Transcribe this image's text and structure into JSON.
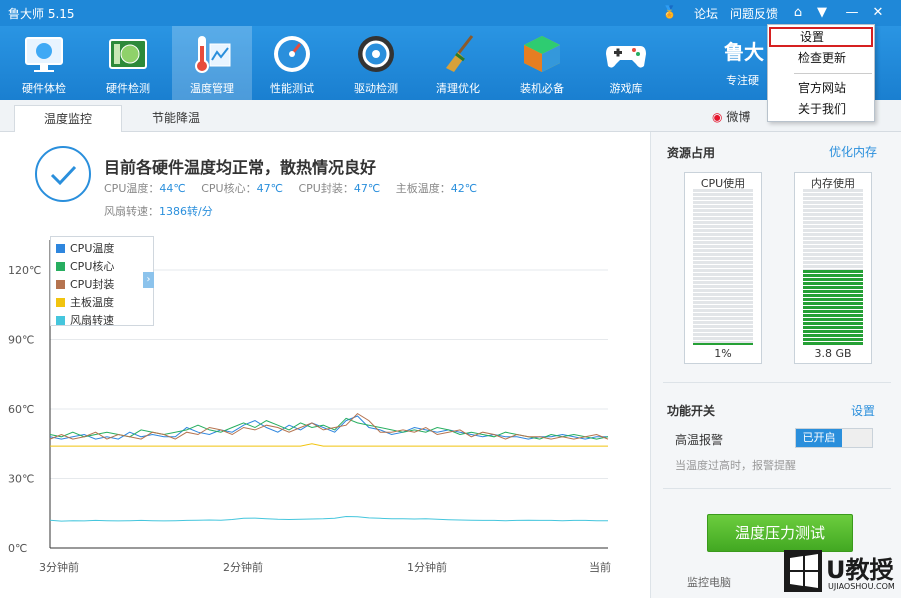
{
  "app": {
    "title": "鲁大师 5.15",
    "forum": "论坛",
    "feedback": "问题反馈",
    "brand": "鲁大",
    "brand_sub": "专注硬"
  },
  "toolbar": [
    {
      "label": "硬件体检",
      "icon": "monitor-check-icon",
      "active": false
    },
    {
      "label": "硬件检测",
      "icon": "hardware-card-icon",
      "active": false
    },
    {
      "label": "温度管理",
      "icon": "thermometer-icon",
      "active": true
    },
    {
      "label": "性能测试",
      "icon": "speedometer-icon",
      "active": false
    },
    {
      "label": "驱动检测",
      "icon": "gear-drive-icon",
      "active": false
    },
    {
      "label": "清理优化",
      "icon": "broom-icon",
      "active": false
    },
    {
      "label": "装机必备",
      "icon": "cube-box-icon",
      "active": false
    },
    {
      "label": "游戏库",
      "icon": "gamepad-icon",
      "active": false
    }
  ],
  "tabs": [
    {
      "label": "温度监控",
      "active": true
    },
    {
      "label": "节能降温",
      "active": false
    }
  ],
  "weibo": "微博",
  "status": {
    "headline": "目前各硬件温度均正常，散热情况良好",
    "cpu_temp_label": "CPU温度：",
    "cpu_temp": "44℃",
    "cpu_core_label": "CPU核心：",
    "cpu_core": "47℃",
    "cpu_pkg_label": "CPU封装：",
    "cpu_pkg": "47℃",
    "board_label": "主板温度：",
    "board": "42℃",
    "fan_label": "风扇转速：",
    "fan": "1386转/分"
  },
  "chart_data": {
    "type": "line",
    "ylabels": [
      "120℃",
      "90℃",
      "60℃",
      "30℃",
      "0℃"
    ],
    "ylim": [
      0,
      120
    ],
    "xlabels": [
      "3分钟前",
      "2分钟前",
      "1分钟前",
      "当前"
    ],
    "grid": true,
    "legend_position": "top-left",
    "series": [
      {
        "name": "CPU温度",
        "color": "#2e86de",
        "values": [
          48,
          47,
          48,
          49,
          47,
          48,
          47,
          50,
          48,
          49,
          48,
          48,
          52,
          50,
          49,
          51,
          50,
          53,
          55,
          52,
          50,
          53,
          51,
          54,
          52,
          50,
          55,
          57,
          52,
          51,
          49,
          50,
          52,
          51,
          50,
          51,
          50,
          49,
          48,
          49,
          48,
          48,
          47,
          48,
          48,
          49,
          48,
          47,
          48,
          48
        ]
      },
      {
        "name": "CPU核心",
        "color": "#27ae60",
        "values": [
          49,
          48,
          50,
          48,
          49,
          50,
          49,
          48,
          51,
          50,
          49,
          50,
          51,
          53,
          51,
          50,
          52,
          54,
          52,
          55,
          53,
          51,
          54,
          52,
          53,
          51,
          56,
          54,
          53,
          52,
          51,
          50,
          51,
          50,
          52,
          51,
          49,
          50,
          49,
          48,
          50,
          49,
          48,
          47,
          49,
          48,
          49,
          48,
          47,
          48
        ]
      },
      {
        "name": "CPU封装",
        "color": "#b5734f",
        "values": [
          47,
          49,
          47,
          48,
          50,
          47,
          49,
          48,
          47,
          50,
          49,
          47,
          50,
          49,
          52,
          51,
          49,
          52,
          51,
          53,
          52,
          50,
          52,
          54,
          51,
          52,
          53,
          58,
          55,
          50,
          50,
          51,
          50,
          52,
          49,
          50,
          51,
          48,
          50,
          49,
          47,
          49,
          48,
          48,
          47,
          48,
          47,
          48,
          49,
          47
        ]
      },
      {
        "name": "主板温度",
        "color": "#f1c40f",
        "values": [
          44,
          44,
          44,
          44,
          44,
          44,
          44,
          44,
          44,
          44,
          44,
          44,
          44,
          44,
          44,
          44,
          44,
          44,
          44,
          44,
          44,
          44,
          44,
          45,
          44,
          44,
          44,
          44,
          44,
          44,
          44,
          44,
          44,
          44,
          44,
          44,
          44,
          44,
          44,
          44,
          44,
          44,
          44,
          44,
          44,
          44,
          44,
          44,
          44,
          44
        ]
      },
      {
        "name": "风扇转速",
        "color": "#45c6dd",
        "values": [
          12,
          11.6,
          11.8,
          11.7,
          11.9,
          11.8,
          11.7,
          11.8,
          11.9,
          11.8,
          11.7,
          11.8,
          11.9,
          12,
          12.1,
          12,
          12.3,
          12.8,
          12.9,
          12.6,
          12.4,
          12.3,
          12.4,
          12.5,
          12.6,
          12.8,
          13.6,
          13.5,
          13,
          12.8,
          12.6,
          12.6,
          12.5,
          12.6,
          12.4,
          12.2,
          12.1,
          12,
          11.9,
          11.9,
          11.8,
          11.9,
          12,
          11.9,
          11.9,
          11.8,
          11.9,
          11.9,
          11.8,
          11.8
        ]
      }
    ]
  },
  "sidebar": {
    "resources_title": "资源占用",
    "optimize_memory": "优化内存",
    "cpu": {
      "label": "CPU使用",
      "value": "1%",
      "fraction": 0.01
    },
    "memory": {
      "label": "内存使用",
      "value": "3.8 GB",
      "fraction": 0.48
    },
    "switches_title": "功能开关",
    "switches_settings": "设置",
    "alarm_label": "高温报警",
    "alarm_state": "已开启",
    "alarm_hint": "当温度过高时，报警提醒",
    "stress_button": "温度压力测试",
    "monitor_text": "监控电脑"
  },
  "menu": {
    "items": [
      "设置",
      "检查更新",
      "官方网站",
      "关于我们"
    ]
  },
  "watermark": {
    "text": "U教授",
    "sub": "UJIAOSHOU.COM"
  },
  "colors": {
    "accent": "#1f88d8",
    "green": "#42a822",
    "highlight": "#d62020"
  }
}
